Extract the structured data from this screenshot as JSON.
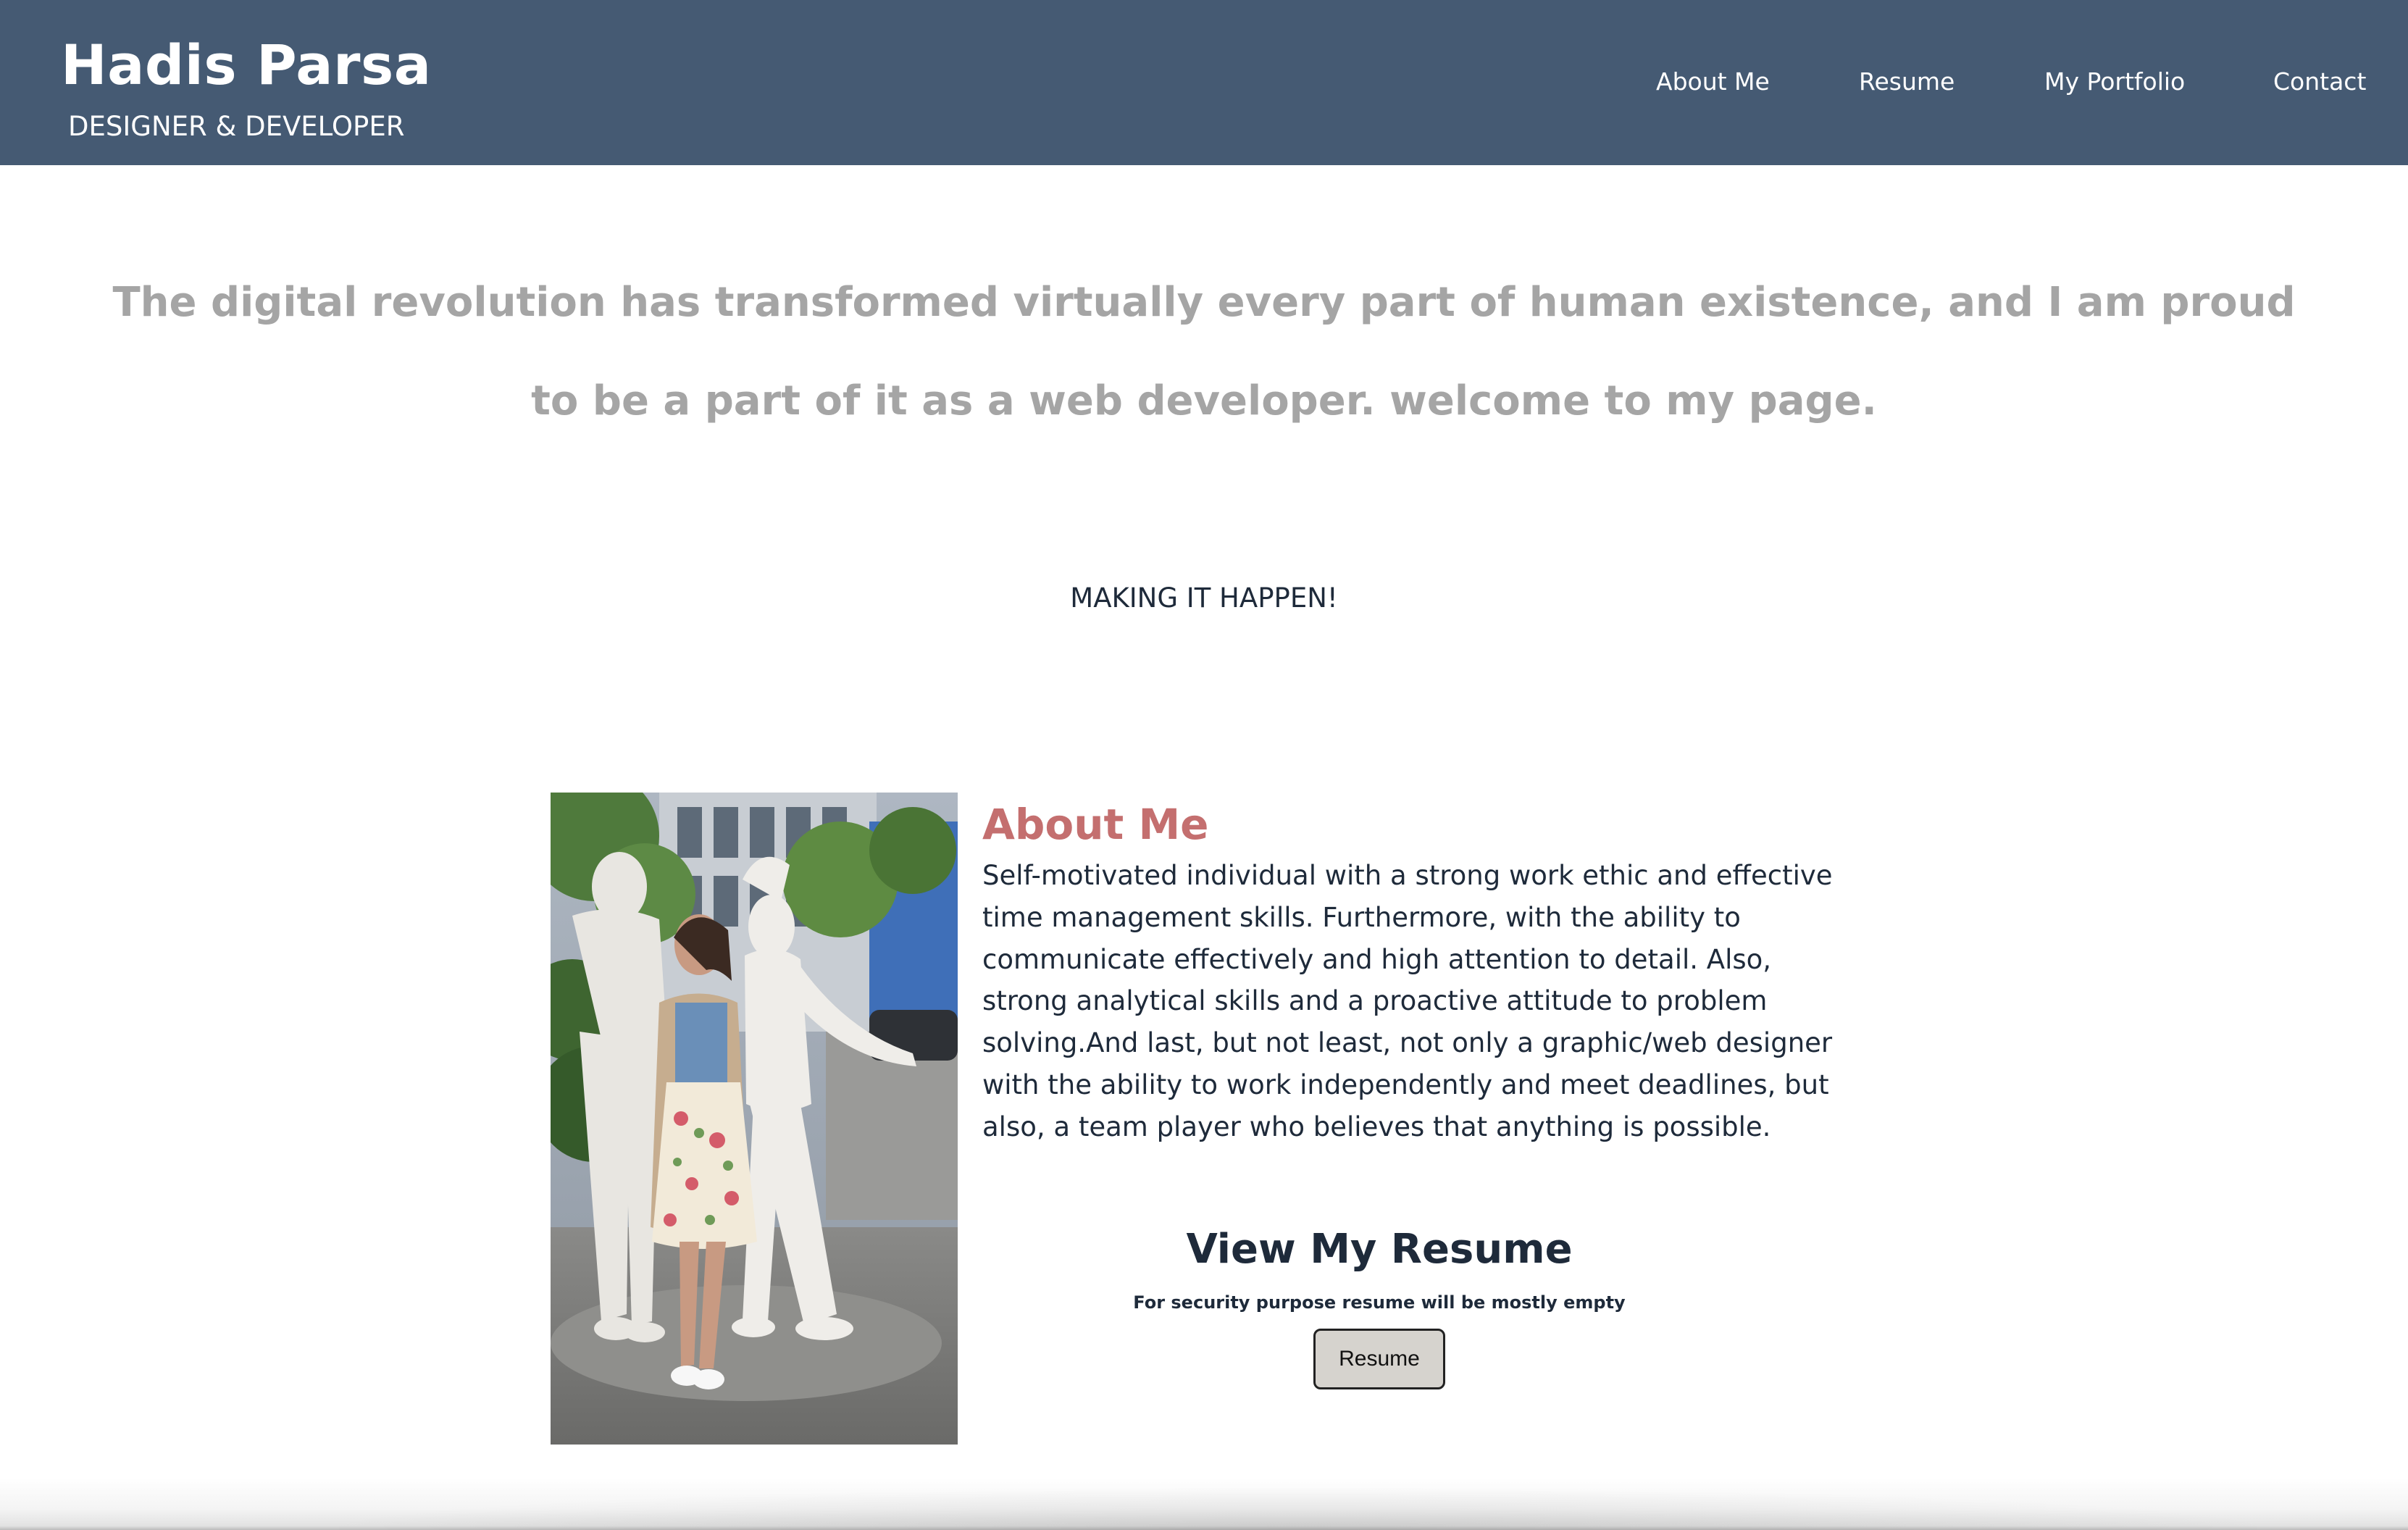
{
  "header": {
    "brand_name": "Hadis Parsa",
    "tagline": "DESIGNER & DEVELOPER",
    "nav": {
      "about": "About Me",
      "resume": "Resume",
      "portfolio": "My Portfolio",
      "contact": "Contact"
    }
  },
  "intro": {
    "quote": "The digital revolution has transformed virtually every part of human existence, and I am proud to be a part of it as a web developer. welcome to my page.",
    "slogan": "MAKING IT HAPPEN!"
  },
  "about": {
    "heading": "About Me",
    "text": "Self-motivated individual with a strong work ethic and effective time management skills. Furthermore, with the ability to communicate effectively and high attention to detail. Also, strong analytical skills and a proactive attitude to problem solving.And last, but not least, not only a graphic/web designer with the ability to work independently and meet deadlines, but also, a team player who believes that anything is possible."
  },
  "resume": {
    "heading": "View My Resume",
    "note": "For security purpose resume will be mostly empty",
    "button_label": "Resume"
  },
  "colors": {
    "header_bg": "#455a73",
    "quote_text": "#a5a5a5",
    "about_heading": "#c46f6f",
    "body_text": "#1e2a3a",
    "button_bg": "#d6d3ce"
  }
}
